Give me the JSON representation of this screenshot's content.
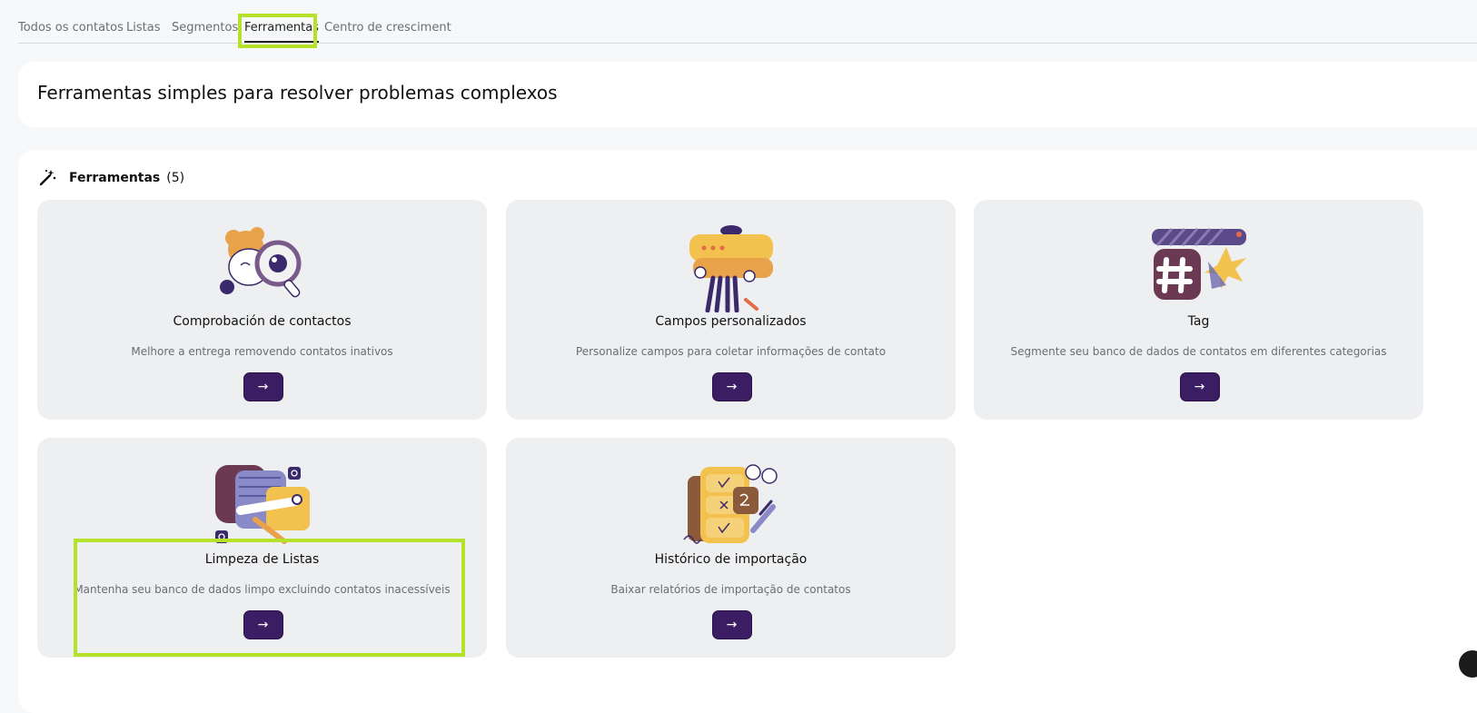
{
  "tabs": [
    {
      "label": "Todos os contatos",
      "active": false
    },
    {
      "label": "Listas",
      "active": false
    },
    {
      "label": "Segmentos",
      "active": false
    },
    {
      "label": "Ferramentas",
      "active": true
    },
    {
      "label": "Centro de cresciment",
      "active": false
    }
  ],
  "hero": {
    "title": "Ferramentas simples para resolver problemas complexos"
  },
  "tools_panel": {
    "title": "Ferramentas",
    "count": "(5)"
  },
  "cards": [
    {
      "title": "Comprobación de contactos",
      "description": "Melhore a entrega removendo contatos inativos",
      "button": "→",
      "icon": "magnifier-eye-illustration"
    },
    {
      "title": "Campos personalizados",
      "description": "Personalize campos para coletar informações de contato",
      "button": "→",
      "icon": "person-holding-fields-illustration"
    },
    {
      "title": "Tag",
      "description": "Segmente seu banco de dados de contatos em diferentes categorias",
      "button": "→",
      "icon": "hashtag-illustration"
    },
    {
      "title": "Limpeza de Listas",
      "description": "Mantenha seu banco de dados limpo excluindo contatos inacessíveis",
      "button": "→",
      "icon": "list-cleaning-illustration"
    },
    {
      "title": "Histórico de importação",
      "description": "Baixar relatórios de importação de contatos",
      "button": "→",
      "icon": "calculator-report-illustration"
    }
  ],
  "colors": {
    "accent_button": "#3a1d63",
    "highlight": "#b6e12a",
    "card_bg": "#eeeff1"
  }
}
